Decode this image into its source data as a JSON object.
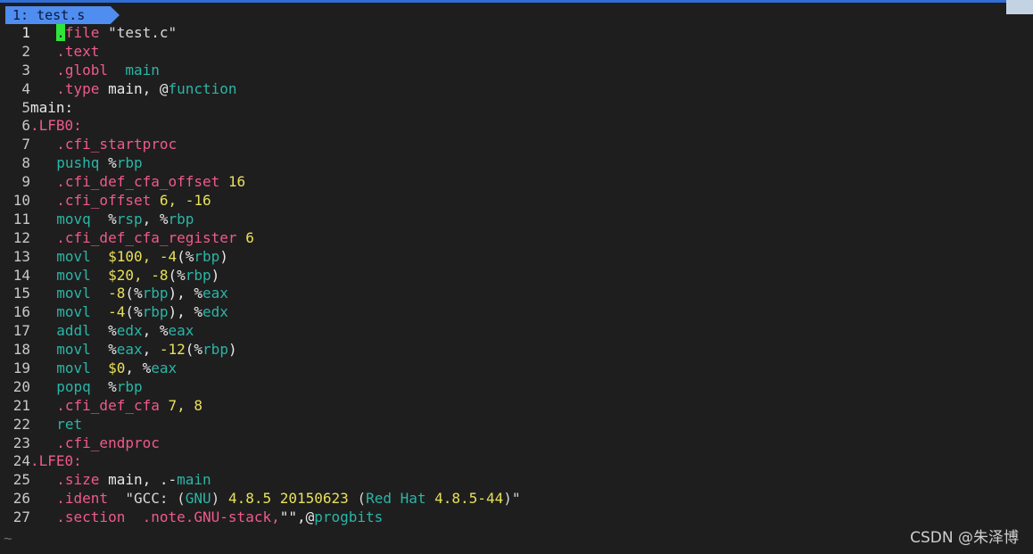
{
  "tab": {
    "number": "1:",
    "filename": "test.s"
  },
  "lines": [
    {
      "n": "1",
      "parts": [
        {
          "t": ".",
          "c": "cursor"
        },
        {
          "t": "file ",
          "c": "dir"
        },
        {
          "t": "\"test.c\"",
          "c": "str"
        }
      ]
    },
    {
      "n": "2",
      "parts": [
        {
          "t": ".text",
          "c": "dir"
        }
      ]
    },
    {
      "n": "3",
      "parts": [
        {
          "t": ".globl  ",
          "c": "dir"
        },
        {
          "t": "main",
          "c": "ins"
        }
      ]
    },
    {
      "n": "4",
      "parts": [
        {
          "t": ".type ",
          "c": "dir"
        },
        {
          "t": "main, @",
          "c": "txt"
        },
        {
          "t": "function",
          "c": "ins"
        }
      ]
    },
    {
      "n": "5",
      "label": true,
      "parts": [
        {
          "t": "main:",
          "c": "txt"
        }
      ]
    },
    {
      "n": "6",
      "label": true,
      "parts": [
        {
          "t": ".LFB0:",
          "c": "lbl"
        }
      ]
    },
    {
      "n": "7",
      "parts": [
        {
          "t": ".cfi_startproc",
          "c": "dir"
        }
      ]
    },
    {
      "n": "8",
      "parts": [
        {
          "t": "pushq ",
          "c": "ins"
        },
        {
          "t": "%",
          "c": "txt"
        },
        {
          "t": "rbp",
          "c": "reg"
        }
      ]
    },
    {
      "n": "9",
      "parts": [
        {
          "t": ".cfi_def_cfa_offset ",
          "c": "dir"
        },
        {
          "t": "16",
          "c": "num"
        }
      ]
    },
    {
      "n": "10",
      "parts": [
        {
          "t": ".cfi_offset ",
          "c": "dir"
        },
        {
          "t": "6, -16",
          "c": "num"
        }
      ]
    },
    {
      "n": "11",
      "parts": [
        {
          "t": "movq  ",
          "c": "ins"
        },
        {
          "t": "%",
          "c": "txt"
        },
        {
          "t": "rsp",
          "c": "reg"
        },
        {
          "t": ", %",
          "c": "txt"
        },
        {
          "t": "rbp",
          "c": "reg"
        }
      ]
    },
    {
      "n": "12",
      "parts": [
        {
          "t": ".cfi_def_cfa_register ",
          "c": "dir"
        },
        {
          "t": "6",
          "c": "num"
        }
      ]
    },
    {
      "n": "13",
      "parts": [
        {
          "t": "movl  ",
          "c": "ins"
        },
        {
          "t": "$100, -4",
          "c": "num"
        },
        {
          "t": "(%",
          "c": "txt"
        },
        {
          "t": "rbp",
          "c": "reg"
        },
        {
          "t": ")",
          "c": "txt"
        }
      ]
    },
    {
      "n": "14",
      "parts": [
        {
          "t": "movl  ",
          "c": "ins"
        },
        {
          "t": "$20, -8",
          "c": "num"
        },
        {
          "t": "(%",
          "c": "txt"
        },
        {
          "t": "rbp",
          "c": "reg"
        },
        {
          "t": ")",
          "c": "txt"
        }
      ]
    },
    {
      "n": "15",
      "parts": [
        {
          "t": "movl  ",
          "c": "ins"
        },
        {
          "t": "-8",
          "c": "num"
        },
        {
          "t": "(%",
          "c": "txt"
        },
        {
          "t": "rbp",
          "c": "reg"
        },
        {
          "t": "), %",
          "c": "txt"
        },
        {
          "t": "eax",
          "c": "reg"
        }
      ]
    },
    {
      "n": "16",
      "parts": [
        {
          "t": "movl  ",
          "c": "ins"
        },
        {
          "t": "-4",
          "c": "num"
        },
        {
          "t": "(%",
          "c": "txt"
        },
        {
          "t": "rbp",
          "c": "reg"
        },
        {
          "t": "), %",
          "c": "txt"
        },
        {
          "t": "edx",
          "c": "reg"
        }
      ]
    },
    {
      "n": "17",
      "parts": [
        {
          "t": "addl  ",
          "c": "ins"
        },
        {
          "t": "%",
          "c": "txt"
        },
        {
          "t": "edx",
          "c": "reg"
        },
        {
          "t": ", %",
          "c": "txt"
        },
        {
          "t": "eax",
          "c": "reg"
        }
      ]
    },
    {
      "n": "18",
      "parts": [
        {
          "t": "movl  ",
          "c": "ins"
        },
        {
          "t": "%",
          "c": "txt"
        },
        {
          "t": "eax",
          "c": "reg"
        },
        {
          "t": ", ",
          "c": "txt"
        },
        {
          "t": "-12",
          "c": "num"
        },
        {
          "t": "(%",
          "c": "txt"
        },
        {
          "t": "rbp",
          "c": "reg"
        },
        {
          "t": ")",
          "c": "txt"
        }
      ]
    },
    {
      "n": "19",
      "parts": [
        {
          "t": "movl  ",
          "c": "ins"
        },
        {
          "t": "$0",
          "c": "num"
        },
        {
          "t": ", %",
          "c": "txt"
        },
        {
          "t": "eax",
          "c": "reg"
        }
      ]
    },
    {
      "n": "20",
      "parts": [
        {
          "t": "popq  ",
          "c": "ins"
        },
        {
          "t": "%",
          "c": "txt"
        },
        {
          "t": "rbp",
          "c": "reg"
        }
      ]
    },
    {
      "n": "21",
      "parts": [
        {
          "t": ".cfi_def_cfa ",
          "c": "dir"
        },
        {
          "t": "7, 8",
          "c": "num"
        }
      ]
    },
    {
      "n": "22",
      "parts": [
        {
          "t": "ret",
          "c": "ins"
        }
      ]
    },
    {
      "n": "23",
      "parts": [
        {
          "t": ".cfi_endproc",
          "c": "dir"
        }
      ]
    },
    {
      "n": "24",
      "label": true,
      "parts": [
        {
          "t": ".LFE0:",
          "c": "lbl"
        }
      ]
    },
    {
      "n": "25",
      "parts": [
        {
          "t": ".size ",
          "c": "dir"
        },
        {
          "t": "main, .-",
          "c": "txt"
        },
        {
          "t": "main",
          "c": "ins"
        }
      ]
    },
    {
      "n": "26",
      "parts": [
        {
          "t": ".ident  ",
          "c": "dir"
        },
        {
          "t": "\"GCC: (",
          "c": "str"
        },
        {
          "t": "GNU",
          "c": "reg"
        },
        {
          "t": ") ",
          "c": "str"
        },
        {
          "t": "4.8.5 20150623 ",
          "c": "num"
        },
        {
          "t": "(",
          "c": "str"
        },
        {
          "t": "Red Hat ",
          "c": "reg"
        },
        {
          "t": "4.8.5-44",
          "c": "num"
        },
        {
          "t": ")\"",
          "c": "str"
        }
      ]
    },
    {
      "n": "27",
      "parts": [
        {
          "t": ".section  .note.GNU-stack,",
          "c": "dir"
        },
        {
          "t": "\"\",@",
          "c": "txt"
        },
        {
          "t": "progbits",
          "c": "ins"
        }
      ]
    }
  ],
  "tilde": "~",
  "watermark": "CSDN @朱泽博",
  "colors": {
    "directive": "#f05a8c",
    "instruction": "#2bb5a6",
    "number": "#e8e05a",
    "tab": "#4f8df0",
    "cursor": "#2ee63a"
  }
}
